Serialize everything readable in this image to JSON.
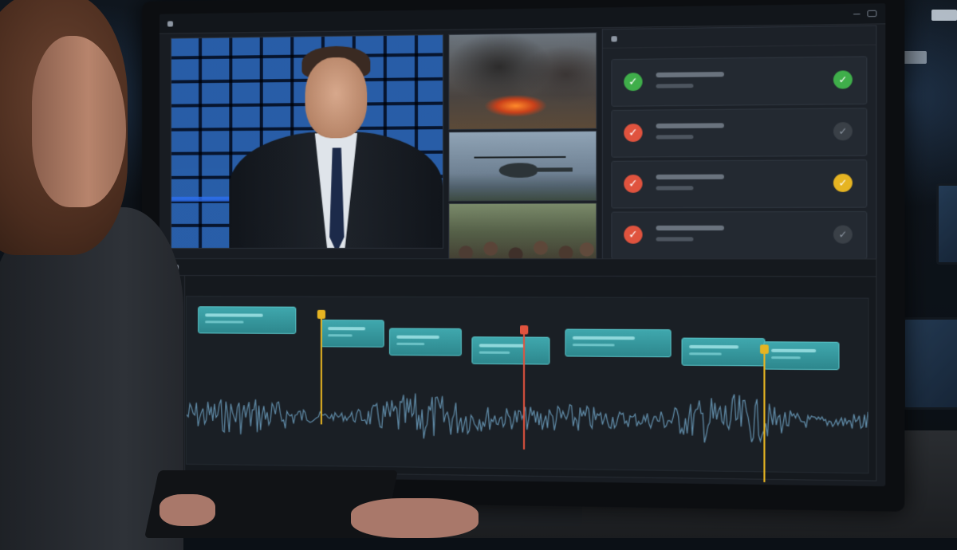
{
  "app": {
    "title": "",
    "window_controls": [
      "minimize",
      "restore"
    ]
  },
  "panels": {
    "program_monitor": {
      "label": ""
    },
    "checklist": {
      "label": ""
    },
    "timeline": {
      "label": "",
      "sequence_label": ""
    }
  },
  "sources": [
    {
      "name": "fire-smoke-footage",
      "icon": "fire-thumbnail"
    },
    {
      "name": "helicopter-footage",
      "icon": "helicopter-thumbnail"
    },
    {
      "name": "crowd-footage",
      "icon": "crowd-thumbnail"
    }
  ],
  "checklist_items": [
    {
      "status": "approved",
      "status_color": "#3fae4a",
      "verify": "verified",
      "verify_color": "#3fae4a"
    },
    {
      "status": "flagged",
      "status_color": "#e0533e",
      "verify": "pending",
      "verify_color": "#3a4047"
    },
    {
      "status": "flagged",
      "status_color": "#e0533e",
      "verify": "warning",
      "verify_color": "#e6b422"
    },
    {
      "status": "flagged",
      "status_color": "#e0533e",
      "verify": "pending",
      "verify_color": "#3a4047"
    }
  ],
  "timeline": {
    "clip_count": 7,
    "markers": [
      {
        "color": "#e6b422",
        "type": "yellow-marker"
      },
      {
        "color": "#e0533e",
        "type": "red-marker"
      },
      {
        "color": "#e6b422",
        "type": "yellow-marker"
      }
    ]
  },
  "colors": {
    "accent_teal": "#3fa7ad",
    "approved": "#3fae4a",
    "flagged": "#e0533e",
    "warning": "#e6b422"
  }
}
